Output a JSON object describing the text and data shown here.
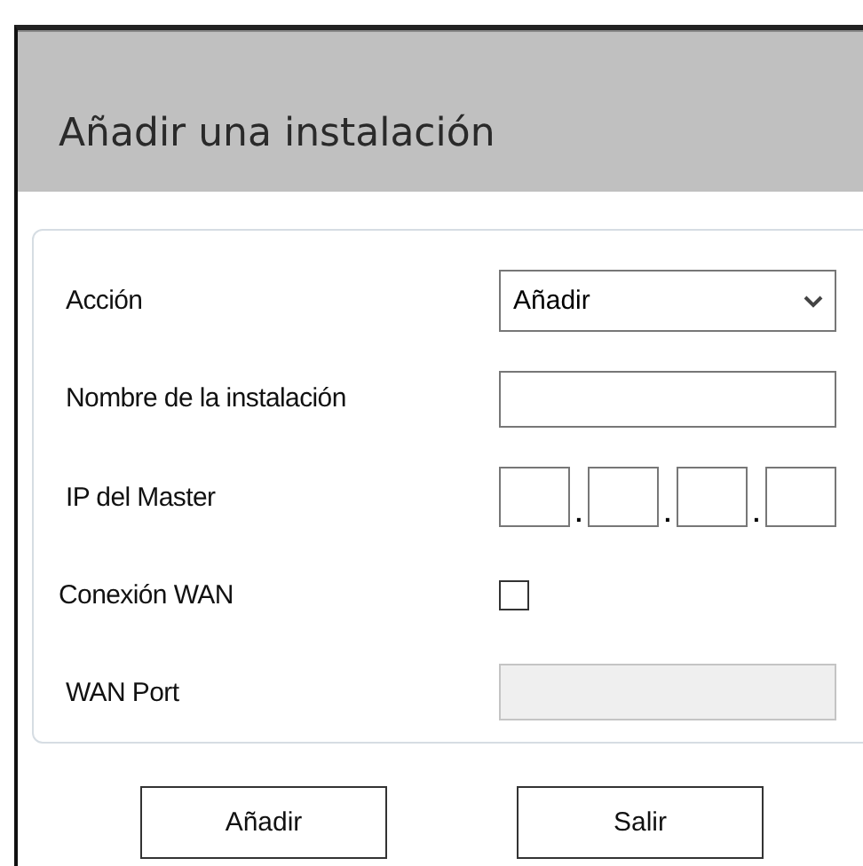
{
  "window": {
    "title": "Añadir una instalación"
  },
  "fields": [
    {
      "kind": "select",
      "label": "Acción",
      "value": "Añadir"
    },
    {
      "kind": "text",
      "label": "Nombre de la instalación",
      "disabled": false
    },
    {
      "kind": "ip",
      "label": "IP del Master",
      "separator": "."
    },
    {
      "kind": "checkbox",
      "label": "Conexión WAN",
      "checked": false
    },
    {
      "kind": "text",
      "label": "WAN Port",
      "disabled": true
    }
  ],
  "buttons": [
    "Añadir",
    "Salir"
  ]
}
